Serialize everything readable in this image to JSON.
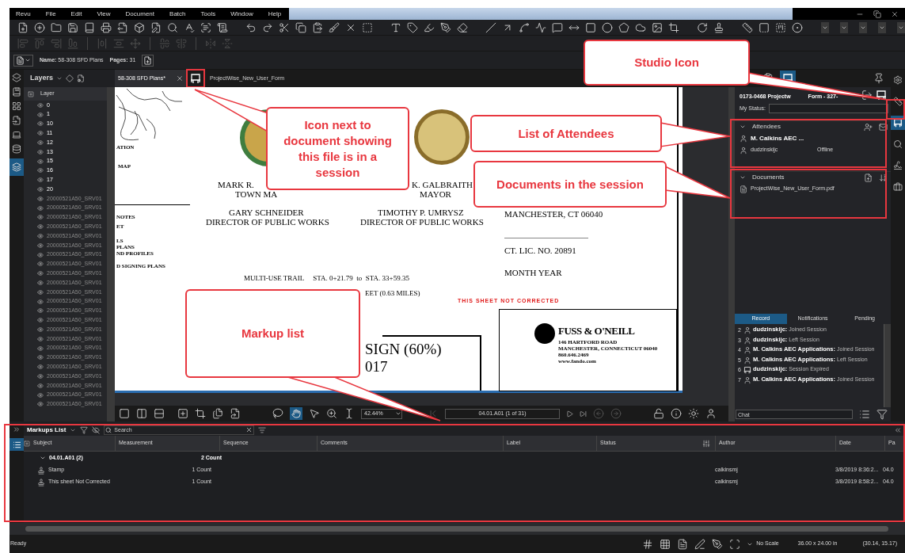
{
  "menu": [
    "Revu",
    "File",
    "Edit",
    "View",
    "Document",
    "Batch",
    "Tools",
    "Window",
    "Help"
  ],
  "doc_info": {
    "name_label": "Name:",
    "name": "58-308 SFD Plans",
    "pages_label": "Pages:",
    "pages": "31"
  },
  "layers": {
    "title": "Layers",
    "header": "Layer",
    "items": [
      {
        "label": "0",
        "dimmed": false
      },
      {
        "label": "1",
        "dimmed": false
      },
      {
        "label": "10",
        "dimmed": false
      },
      {
        "label": "11",
        "dimmed": false
      },
      {
        "label": "12",
        "dimmed": false
      },
      {
        "label": "13",
        "dimmed": false
      },
      {
        "label": "15",
        "dimmed": false
      },
      {
        "label": "16",
        "dimmed": false
      },
      {
        "label": "17",
        "dimmed": false
      },
      {
        "label": "20",
        "dimmed": false
      },
      {
        "label": "20000521A50_SRV01",
        "dimmed": true
      },
      {
        "label": "20000521A50_SRV01",
        "dimmed": true
      },
      {
        "label": "20000521A50_SRV01",
        "dimmed": true
      },
      {
        "label": "20000521A50_SRV01",
        "dimmed": true
      },
      {
        "label": "20000521A50_SRV01",
        "dimmed": true
      },
      {
        "label": "20000521A50_SRV01",
        "dimmed": true
      },
      {
        "label": "20000521A50_SRV01",
        "dimmed": true
      },
      {
        "label": "20000521A50_SRV01",
        "dimmed": true
      },
      {
        "label": "20000521A50_SRV01",
        "dimmed": true
      },
      {
        "label": "20000521A50_SRV01",
        "dimmed": true
      },
      {
        "label": "20000521A50_SRV01",
        "dimmed": true
      },
      {
        "label": "20000521A50_SRV01",
        "dimmed": true
      },
      {
        "label": "20000521A50_SRV01",
        "dimmed": true
      },
      {
        "label": "20000521A50_SRV01",
        "dimmed": true
      },
      {
        "label": "20000521A50_SRV01",
        "dimmed": true
      },
      {
        "label": "20000521A50_SRV01",
        "dimmed": true
      },
      {
        "label": "20000521A50_SRV01",
        "dimmed": true
      },
      {
        "label": "20000521A50_SRV01",
        "dimmed": true
      },
      {
        "label": "20000521A50_SRV01",
        "dimmed": true
      },
      {
        "label": "20000521A50_SRV01",
        "dimmed": true
      },
      {
        "label": "20000521A50_SRV01",
        "dimmed": true
      },
      {
        "label": "20000521A50_SRV01",
        "dimmed": true
      },
      {
        "label": "20000521A50_SRV01",
        "dimmed": true
      }
    ]
  },
  "tabs": [
    {
      "label": "58-308 SFD Plans*",
      "selected": true,
      "closable": true,
      "in_session": false
    },
    {
      "label": "ProjectWise_New_User_Form",
      "selected": false,
      "closable": false,
      "in_session": true
    }
  ],
  "sheet": {
    "texts": [
      {
        "kind": "tiny",
        "text": "ATION"
      },
      {
        "kind": "tiny",
        "text": "MAP"
      },
      {
        "kind": "tiny",
        "text": "NOTES"
      },
      {
        "kind": "tiny",
        "text": "ET"
      },
      {
        "kind": "tiny",
        "text": "LS"
      },
      {
        "kind": "tiny",
        "text": "PLANS"
      },
      {
        "kind": "tiny",
        "text": "ND PROFILES"
      },
      {
        "kind": "tiny",
        "text": "D SIGNING PLANS"
      },
      {
        "kind": "name",
        "text": "MARK R."
      },
      {
        "kind": "name",
        "text": "TOWN MA"
      },
      {
        "kind": "name",
        "text": "K. GALBRAITH"
      },
      {
        "kind": "name",
        "text": "MAYOR"
      },
      {
        "kind": "name",
        "text": "GARY SCHNEIDER"
      },
      {
        "kind": "name",
        "text": "DIRECTOR OF PUBLIC WORKS"
      },
      {
        "kind": "name",
        "text": "TIMOTHY P. UMRYSZ"
      },
      {
        "kind": "name",
        "text": "DIRECTOR OF PUBLIC WORKS"
      },
      {
        "kind": "name",
        "text": "MANCHESTER, CT  06040"
      },
      {
        "kind": "name",
        "text": "CT. LIC. NO. 20891"
      },
      {
        "kind": "name",
        "text": "MONTH YEAR"
      },
      {
        "kind": "small",
        "text": "MULTI-USE TRAIL     STA. 0+21.79  to  STA. 33+59.35"
      },
      {
        "kind": "small",
        "text": "EET (0.63 MILES)"
      },
      {
        "kind": "stamp",
        "text": "THIS SHEET NOT CORRECTED"
      },
      {
        "kind": "big",
        "text": "SIGN (60%)"
      },
      {
        "kind": "big",
        "text": "017"
      },
      {
        "kind": "logo",
        "text": "FUSS & O'NEILL"
      },
      {
        "kind": "tiny",
        "text": "146 HARTFORD ROAD"
      },
      {
        "kind": "tiny",
        "text": "MANCHESTER, CONNECTICUT 06040"
      },
      {
        "kind": "tiny",
        "text": "860.646.2469"
      },
      {
        "kind": "tiny",
        "text": "www.fando.com"
      }
    ]
  },
  "view_bar": {
    "zoom": "42.44%",
    "page": "04.01.A01 (1 of 31)"
  },
  "studio": {
    "session_title": "0173-0468 Projectw",
    "session_title_end": "Form - 327-",
    "status_label": "My Status:",
    "attendees": {
      "title": "Attendees",
      "expanded": true,
      "items": [
        {
          "name": "M. Calkins AEC ...",
          "emphasized": true
        },
        {
          "name": "dudzinskijc",
          "emphasized": false,
          "status": "Offline"
        }
      ]
    },
    "documents": {
      "title": "Documents",
      "expanded": true,
      "items": [
        "ProjectWise_New_User_Form.pdf"
      ]
    },
    "tabs": [
      {
        "label": "Record",
        "selected": true
      },
      {
        "label": "Notifications",
        "selected": false
      },
      {
        "label": "Pending",
        "selected": false
      }
    ],
    "record": [
      {
        "num": "2",
        "kind": "person",
        "user": "dudzinskijc:",
        "action": "Joined Session"
      },
      {
        "num": "3",
        "kind": "person",
        "user": "dudzinskijc:",
        "action": "Left Session"
      },
      {
        "num": "4",
        "kind": "person",
        "user": "M. Calkins AEC Applications:",
        "action": "Joined Session"
      },
      {
        "num": "5",
        "kind": "person",
        "user": "M. Calkins AEC Applications:",
        "action": "Left Session"
      },
      {
        "num": "6",
        "kind": "system",
        "user": "dudzinskijc:",
        "action": "Session Expired"
      },
      {
        "num": "7",
        "kind": "person",
        "user": "M. Calkins AEC Applications:",
        "action": "Joined Session"
      }
    ],
    "chat_placeholder": "Chat"
  },
  "rail": [
    {
      "kind": "gear",
      "selected": false
    },
    {
      "kind": "ruler",
      "selected": false
    },
    {
      "kind": "studio",
      "selected": true
    },
    {
      "kind": "search",
      "selected": false
    },
    {
      "kind": "signature",
      "selected": false
    },
    {
      "kind": "briefcase",
      "selected": false
    }
  ],
  "markups": {
    "title": "Markups List",
    "search_placeholder": "Search",
    "columns": [
      "Subject",
      "Measurement",
      "Sequence",
      "Comments",
      "Label",
      "Status",
      "Author",
      "Date",
      "Pa"
    ],
    "groups": [
      {
        "label": "04.01.A01 (2)",
        "measurement": "2 Count",
        "expanded": true,
        "children": [
          {
            "subject": "Stamp",
            "measurement": "1 Count",
            "author": "calkinsmj",
            "date": "3/8/2019 8:36:2...",
            "page": "04.0"
          },
          {
            "subject": "This sheet Not Corrected",
            "measurement": "1 Count",
            "author": "calkinsmj",
            "date": "3/8/2019 8:58:2...",
            "page": "04.0"
          }
        ]
      }
    ]
  },
  "status_bar": {
    "status": "Ready",
    "scale": "No Scale",
    "size": "36.00 x 24.00 in",
    "coords": "(30.14, 15.17)"
  },
  "annotations": [
    {
      "text": "Studio Icon"
    },
    {
      "text": "Icon next to document showing this file is in a session"
    },
    {
      "text": "List of Attendees"
    },
    {
      "text": "Documents in the session"
    },
    {
      "text": "Markup list"
    }
  ]
}
